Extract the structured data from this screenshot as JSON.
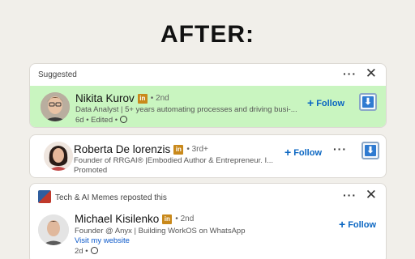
{
  "headline": "AFTER:",
  "colors": {
    "highlight": "#c9f5c0",
    "follow": "#0a66c2",
    "badge": "#c9891b"
  },
  "card1": {
    "header": "Suggested",
    "more_icon": "ellipsis-icon",
    "close_icon": "close-icon",
    "post": {
      "name": "Nikita Kurov",
      "degree": "• 2nd",
      "headline": "Data Analyst | 5+ years automating processes and driving busi-...",
      "meta": "6d • Edited •",
      "follow": "Follow",
      "download_icon": "download-icon"
    }
  },
  "card2": {
    "post": {
      "name": "Roberta De lorenzis",
      "degree": "• 3rd+",
      "headline": "Founder of RRGAI® |Embodied Author  & Entrepreneur. I...",
      "meta": "Promoted",
      "follow": "Follow",
      "more_icon": "ellipsis-icon",
      "download_icon": "download-icon"
    }
  },
  "card3": {
    "header": "Tech & AI Memes reposted this",
    "more_icon": "ellipsis-icon",
    "close_icon": "close-icon",
    "post": {
      "name": "Michael Kisilenko",
      "degree": "• 2nd",
      "headline": "Founder @ Anyx | Building WorkOS on WhatsApp",
      "link": "Visit my website",
      "meta": "2d •",
      "follow": "Follow"
    }
  }
}
